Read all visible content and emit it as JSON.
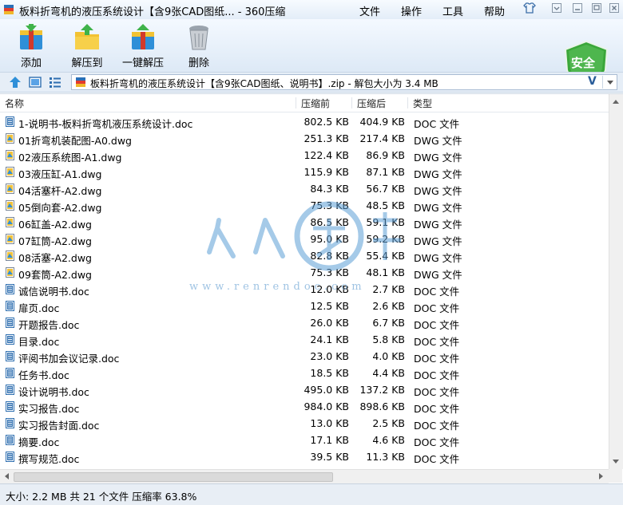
{
  "window": {
    "title": "板料折弯机的液压系统设计【含9张CAD图纸... - 360压缩",
    "menu": [
      "文件",
      "操作",
      "工具",
      "帮助"
    ]
  },
  "toolbar": {
    "add_label": "添加",
    "extract_label": "解压到",
    "oneclick_label": "一键解压",
    "delete_label": "删除",
    "security_label": "安全"
  },
  "address": {
    "path": "板料折弯机的液压系统设计【含9张CAD图纸、说明书】.zip - 解包大小为 3.4 MB"
  },
  "columns": {
    "name": "名称",
    "packed": "压缩前",
    "unpacked": "压缩后",
    "type": "类型"
  },
  "files": [
    {
      "name": "1-说明书-板料折弯机液压系统设计.doc",
      "before": "802.5 KB",
      "after": "404.9 KB",
      "type": "DOC 文件",
      "kind": "doc"
    },
    {
      "name": "01折弯机装配图-A0.dwg",
      "before": "251.3 KB",
      "after": "217.4 KB",
      "type": "DWG 文件",
      "kind": "dwg"
    },
    {
      "name": "02液压系统图-A1.dwg",
      "before": "122.4 KB",
      "after": "86.9 KB",
      "type": "DWG 文件",
      "kind": "dwg"
    },
    {
      "name": "03液压缸-A1.dwg",
      "before": "115.9 KB",
      "after": "87.1 KB",
      "type": "DWG 文件",
      "kind": "dwg"
    },
    {
      "name": "04活塞杆-A2.dwg",
      "before": "84.3 KB",
      "after": "56.7 KB",
      "type": "DWG 文件",
      "kind": "dwg"
    },
    {
      "name": "05倒向套-A2.dwg",
      "before": "75.3 KB",
      "after": "48.5 KB",
      "type": "DWG 文件",
      "kind": "dwg"
    },
    {
      "name": "06缸盖-A2.dwg",
      "before": "86.5 KB",
      "after": "59.1 KB",
      "type": "DWG 文件",
      "kind": "dwg"
    },
    {
      "name": "07缸筒-A2.dwg",
      "before": "95.0 KB",
      "after": "59.2 KB",
      "type": "DWG 文件",
      "kind": "dwg"
    },
    {
      "name": "08活塞-A2.dwg",
      "before": "82.8 KB",
      "after": "55.4 KB",
      "type": "DWG 文件",
      "kind": "dwg"
    },
    {
      "name": "09套筒-A2.dwg",
      "before": "75.3 KB",
      "after": "48.1 KB",
      "type": "DWG 文件",
      "kind": "dwg"
    },
    {
      "name": "诚信说明书.doc",
      "before": "12.0 KB",
      "after": "2.7 KB",
      "type": "DOC 文件",
      "kind": "doc"
    },
    {
      "name": "扉页.doc",
      "before": "12.5 KB",
      "after": "2.6 KB",
      "type": "DOC 文件",
      "kind": "doc"
    },
    {
      "name": "开题报告.doc",
      "before": "26.0 KB",
      "after": "6.7 KB",
      "type": "DOC 文件",
      "kind": "doc"
    },
    {
      "name": "目录.doc",
      "before": "24.1 KB",
      "after": "5.8 KB",
      "type": "DOC 文件",
      "kind": "doc"
    },
    {
      "name": "评阅书加会议记录.doc",
      "before": "23.0 KB",
      "after": "4.0 KB",
      "type": "DOC 文件",
      "kind": "doc"
    },
    {
      "name": "任务书.doc",
      "before": "18.5 KB",
      "after": "4.4 KB",
      "type": "DOC 文件",
      "kind": "doc"
    },
    {
      "name": "设计说明书.doc",
      "before": "495.0 KB",
      "after": "137.2 KB",
      "type": "DOC 文件",
      "kind": "doc"
    },
    {
      "name": "实习报告.doc",
      "before": "984.0 KB",
      "after": "898.6 KB",
      "type": "DOC 文件",
      "kind": "doc"
    },
    {
      "name": "实习报告封面.doc",
      "before": "13.0 KB",
      "after": "2.5 KB",
      "type": "DOC 文件",
      "kind": "doc"
    },
    {
      "name": "摘要.doc",
      "before": "17.1 KB",
      "after": "4.6 KB",
      "type": "DOC 文件",
      "kind": "doc"
    },
    {
      "name": "撰写规范.doc",
      "before": "39.5 KB",
      "after": "11.3 KB",
      "type": "DOC 文件",
      "kind": "doc"
    }
  ],
  "watermark": {
    "text": "人人文库",
    "url": "www.renrendoc.com"
  },
  "status": {
    "text": "大小: 2.2 MB 共 21 个文件 压缩率 63.8%"
  },
  "colors": {
    "accent": "#2a6fb7",
    "shield": "#3aa73a",
    "watermark": "#5d9fd6"
  }
}
